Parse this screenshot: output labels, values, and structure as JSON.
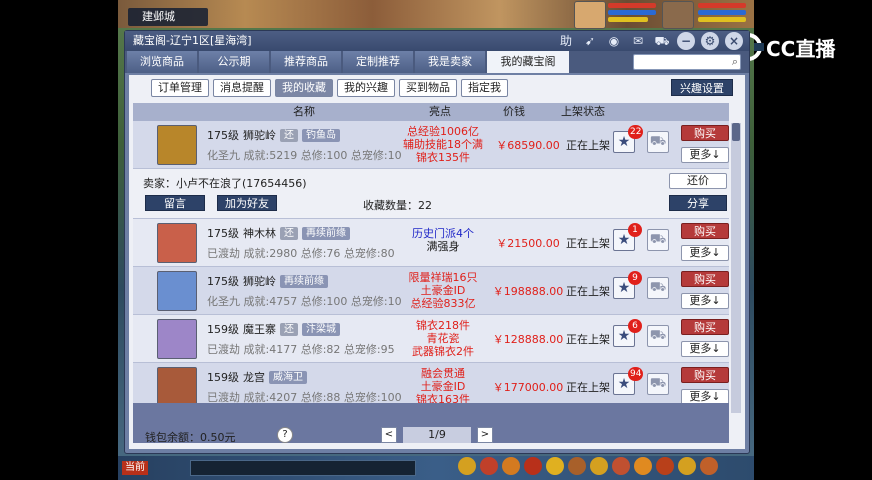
{
  "game": {
    "location": "建邺城",
    "logo_text": "CC直播"
  },
  "window": {
    "title": "藏宝阁-辽宁1区[星海湾]",
    "title_icons": [
      "助",
      "speaker-icon",
      "record-icon",
      "chat-icon",
      "cart-icon",
      "minimize-icon",
      "settings-icon",
      "close-icon"
    ]
  },
  "tabs": [
    "浏览商品",
    "公示期",
    "推荐商品",
    "定制推荐",
    "我是卖家",
    "我的藏宝阁"
  ],
  "active_tab": "我的藏宝阁",
  "subtabs": [
    "订单管理",
    "消息提醒",
    "我的收藏",
    "我的兴趣",
    "买到物品",
    "指定我"
  ],
  "active_subtab": "我的收藏",
  "interest_button": "兴趣设置",
  "columns": {
    "name": "名称",
    "highlight": "亮点",
    "price": "价钱",
    "status": "上架状态"
  },
  "rows": [
    {
      "level": "175级",
      "school": "狮驼岭",
      "flag": "还",
      "tag": "钓鱼岛",
      "stats": "化圣九 成就:5219 总修:100 总宠修:100",
      "highlights": [
        {
          "text": "总经验1006亿",
          "color": "r"
        },
        {
          "text": "辅助技能18个满",
          "color": "r"
        },
        {
          "text": "锦衣135件",
          "color": "r"
        }
      ],
      "price": "￥68590.00",
      "status": "正在上架",
      "fav_count": "22",
      "buy": "购买",
      "more": "更多↓",
      "avatar_color": "#b8862a"
    },
    {
      "level": "175级",
      "school": "神木林",
      "flag": "还",
      "tag": "再续前缘",
      "stats": "已渡劫 成就:2980 总修:76 总宠修:80",
      "highlights": [
        {
          "text": "历史门派4个",
          "color": "b"
        },
        {
          "text": "满强身",
          "color": "k"
        }
      ],
      "price": "￥21500.00",
      "status": "正在上架",
      "fav_count": "1",
      "buy": "购买",
      "more": "更多↓",
      "avatar_color": "#c9604a"
    },
    {
      "level": "175级",
      "school": "狮驼岭",
      "flag": "",
      "tag": "再续前缘",
      "stats": "化圣九 成就:4757 总修:100 总宠修:100",
      "highlights": [
        {
          "text": "限量祥瑞16只",
          "color": "r"
        },
        {
          "text": "土豪金ID",
          "color": "r"
        },
        {
          "text": "总经验833亿",
          "color": "r"
        }
      ],
      "price": "￥198888.00",
      "status": "正在上架",
      "fav_count": "9",
      "buy": "购买",
      "more": "更多↓",
      "avatar_color": "#6a8fd0"
    },
    {
      "level": "159级",
      "school": "魔王寨",
      "flag": "还",
      "tag": "汴梁城",
      "stats": "已渡劫 成就:4177 总修:82 总宠修:95",
      "highlights": [
        {
          "text": "锦衣218件",
          "color": "r"
        },
        {
          "text": "青花瓷",
          "color": "r"
        },
        {
          "text": "武器锦衣2件",
          "color": "r"
        }
      ],
      "price": "￥128888.00",
      "status": "正在上架",
      "fav_count": "6",
      "buy": "购买",
      "more": "更多↓",
      "avatar_color": "#9d86c8"
    },
    {
      "level": "159级",
      "school": "龙宫",
      "flag": "",
      "tag": "威海卫",
      "stats": "已渡劫 成就:4207 总修:88 总宠修:100",
      "highlights": [
        {
          "text": "融会贯通",
          "color": "r"
        },
        {
          "text": "土豪金ID",
          "color": "r"
        },
        {
          "text": "锦衣163件",
          "color": "r"
        }
      ],
      "price": "￥177000.00",
      "status": "正在上架",
      "fav_count": "94",
      "buy": "购买",
      "more": "更多↓",
      "avatar_color": "#a85a3a"
    }
  ],
  "expanded": {
    "seller": "卖家：小卢不在浪了(17654456)",
    "message_btn": "留言",
    "add_friend_btn": "加为好友",
    "fav_count_label": "收藏数量：22",
    "haggle_btn": "还价",
    "share_btn": "分享"
  },
  "footer": {
    "wallet": "钱包余额：0.50元",
    "help": "?",
    "page": "1/9",
    "prev": "<",
    "next": ">"
  },
  "chat": {
    "channel": "当前"
  }
}
